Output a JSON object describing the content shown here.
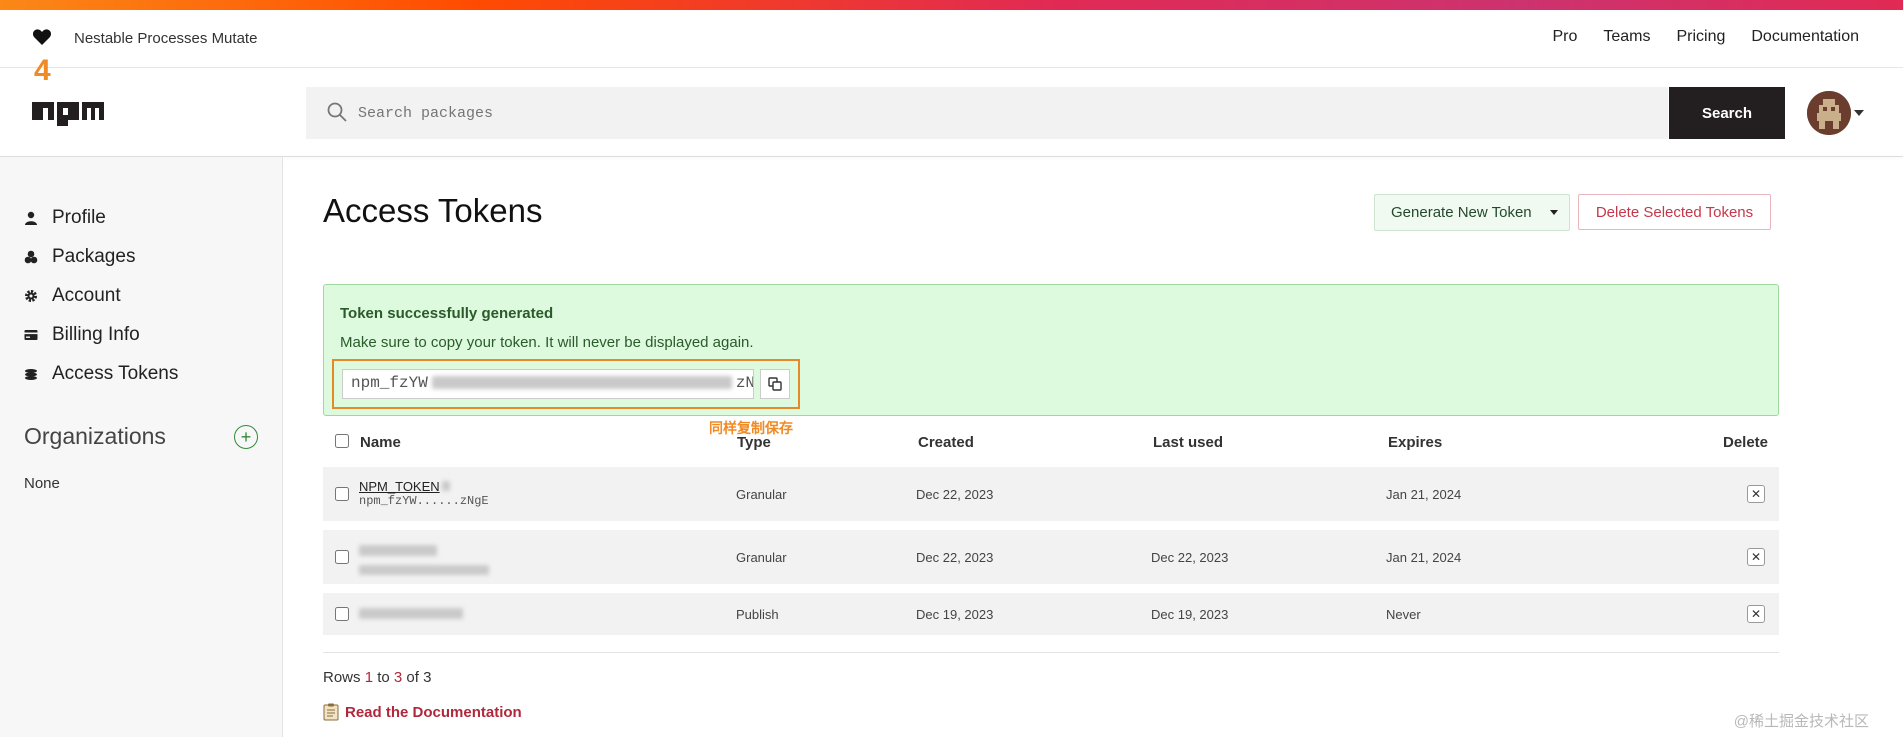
{
  "header": {
    "tagline": "Nestable Processes Mutate",
    "nav": [
      "Pro",
      "Teams",
      "Pricing",
      "Documentation"
    ],
    "search_placeholder": "Search packages",
    "search_button": "Search"
  },
  "annotations": {
    "step_number": "4",
    "note": "同样复制保存",
    "accent_color": "#f08a24"
  },
  "sidebar": {
    "items": [
      {
        "label": "Profile",
        "icon": "user-icon"
      },
      {
        "label": "Packages",
        "icon": "packages-icon"
      },
      {
        "label": "Account",
        "icon": "gear-icon"
      },
      {
        "label": "Billing Info",
        "icon": "credit-card-icon"
      },
      {
        "label": "Access Tokens",
        "icon": "tokens-icon"
      }
    ],
    "organizations_title": "Organizations",
    "organizations_value": "None"
  },
  "main": {
    "title": "Access Tokens",
    "generate_button": "Generate New Token",
    "delete_button": "Delete Selected Tokens",
    "alert": {
      "title": "Token successfully generated",
      "message": "Make sure to copy your token. It will never be displayed again.",
      "token_start": "npm_fzYW",
      "token_end": "zNgE"
    },
    "table": {
      "headers": [
        "Name",
        "Type",
        "Created",
        "Last used",
        "Expires",
        "Delete"
      ],
      "rows": [
        {
          "name": "NPM_TOKEN",
          "sub": "npm_fzYW......zNgE",
          "type": "Granular",
          "created": "Dec 22, 2023",
          "last_used": "",
          "expires": "Jan 21, 2024"
        },
        {
          "name": "",
          "sub": "",
          "type": "Granular",
          "created": "Dec 22, 2023",
          "last_used": "Dec 22, 2023",
          "expires": "Jan 21, 2024"
        },
        {
          "name": "",
          "sub": "",
          "type": "Publish",
          "created": "Dec 19, 2023",
          "last_used": "Dec 19, 2023",
          "expires": "Never"
        }
      ]
    },
    "rows_count_prefix": "Rows ",
    "rows_count_a": "1",
    "rows_count_mid": " to ",
    "rows_count_b": "3",
    "rows_count_of": " of ",
    "rows_count_c": "3",
    "read_docs": "Read the Documentation"
  },
  "watermark": "@稀土掘金技术社区"
}
